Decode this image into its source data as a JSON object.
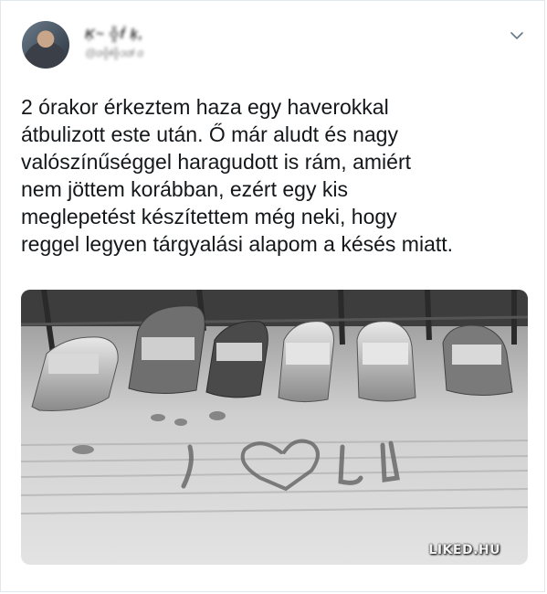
{
  "tweet": {
    "author_name": "Ķ~ ╬ḟ ķ,",
    "author_handle": "@ɑ╬ɬ╬ɔɑɬ ɑ",
    "text_lines": [
      "2 órakor érkeztem haza egy haverokkal",
      "átbulizott este után. Ő már aludt és nagy",
      "valószínűséggel haragudott is rám, amiért",
      "nem jöttem korábban, ezért egy kis",
      "meglepetést készítettem még neki, hogy",
      "reggel legyen tárgyalási alapom a késés miatt."
    ]
  },
  "photo": {
    "watermark": "LIKED.HU",
    "snow_text": "I ♡ U"
  },
  "icons": {
    "menu": "chevron-down-icon"
  }
}
